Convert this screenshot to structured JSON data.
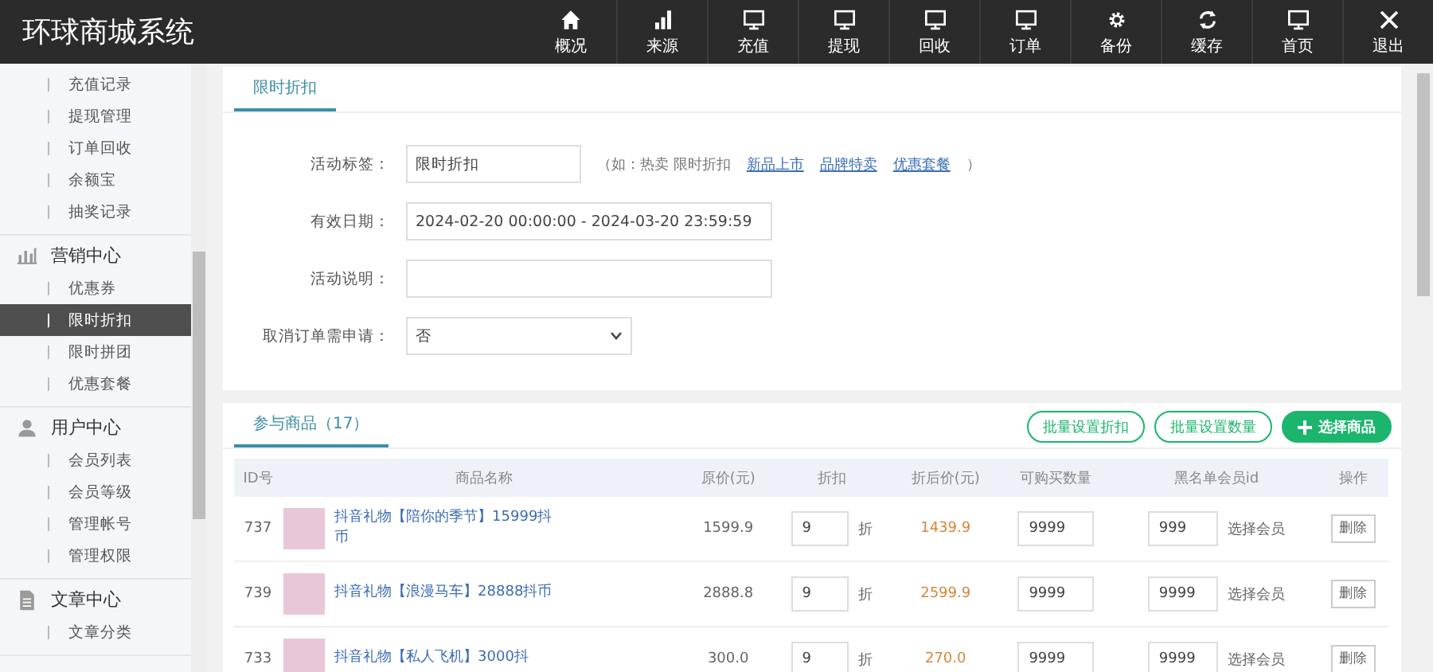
{
  "header": {
    "title": "环球商城系统",
    "nav": [
      {
        "label": "概况"
      },
      {
        "label": "来源"
      },
      {
        "label": "充值"
      },
      {
        "label": "提现"
      },
      {
        "label": "回收"
      },
      {
        "label": "订单"
      },
      {
        "label": "备份"
      },
      {
        "label": "缓存"
      },
      {
        "label": "首页"
      },
      {
        "label": "退出"
      }
    ]
  },
  "sidebar": {
    "groups": [
      {
        "items": [
          {
            "label": "充值记录",
            "selected": false
          },
          {
            "label": "提现管理",
            "selected": false
          },
          {
            "label": "订单回收",
            "selected": false
          },
          {
            "label": "余额宝",
            "selected": false
          },
          {
            "label": "抽奖记录",
            "selected": false
          }
        ]
      },
      {
        "title": "营销中心",
        "items": [
          {
            "label": "优惠券",
            "selected": false
          },
          {
            "label": "限时折扣",
            "selected": true
          },
          {
            "label": "限时拼团",
            "selected": false
          },
          {
            "label": "优惠套餐",
            "selected": false
          }
        ]
      },
      {
        "title": "用户中心",
        "items": [
          {
            "label": "会员列表",
            "selected": false
          },
          {
            "label": "会员等级",
            "selected": false
          },
          {
            "label": "管理帐号",
            "selected": false
          },
          {
            "label": "管理权限",
            "selected": false
          }
        ]
      },
      {
        "title": "文章中心",
        "items": [
          {
            "label": "文章分类",
            "selected": false
          }
        ]
      }
    ]
  },
  "form": {
    "tabs": [
      {
        "label": "限时折扣",
        "selected": true
      }
    ],
    "fields": [
      {
        "kind": "text",
        "label": "活动标签：",
        "value": "限时折扣",
        "hint": "（如：热卖 限时折扣",
        "links": [
          "新品上市",
          "品牌特卖",
          "优惠套餐"
        ],
        "hint_end": "）"
      },
      {
        "kind": "text",
        "label": "有效日期：",
        "value": "2024-02-20 00:00:00 - 2024-03-20 23:59:59"
      },
      {
        "kind": "text",
        "label": "活动说明："
      },
      {
        "kind": "select",
        "label": "取消订单需申请：",
        "value": "否"
      }
    ]
  },
  "products": {
    "tabs": [
      {
        "label": "参与商品（17）",
        "selected": true
      }
    ],
    "buttons": [
      {
        "label": "批量设置折扣",
        "kind": "outline"
      },
      {
        "label": "批量设置数量",
        "kind": "outline"
      },
      {
        "label": "选择商品",
        "kind": "primary"
      }
    ],
    "columns": [
      "ID号",
      "商品名称",
      "原价(元)",
      "折扣",
      "折后价(元)",
      "可购买数量",
      "黑名单会员id",
      "操作"
    ],
    "rows": [
      {
        "id": "737",
        "name": "抖音礼物【陪你的季节】15999抖币",
        "price": "1599.9",
        "discount": "9",
        "unit": "折",
        "final": "1439.9",
        "qty": "9999",
        "blacklist": "999",
        "pick": "选择会员",
        "action": "删除"
      },
      {
        "id": "739",
        "name": "抖音礼物【浪漫马车】28888抖币",
        "price": "2888.8",
        "discount": "9",
        "unit": "折",
        "final": "2599.9",
        "qty": "9999",
        "blacklist": "9999",
        "pick": "选择会员",
        "action": "删除"
      },
      {
        "id": "733",
        "name": "抖音礼物【私人飞机】3000抖",
        "price": "300.0",
        "discount": "9",
        "unit": "折",
        "final": "270.0",
        "qty": "9999",
        "blacklist": "9999",
        "pick": "选择会员",
        "action": "删除"
      }
    ]
  }
}
